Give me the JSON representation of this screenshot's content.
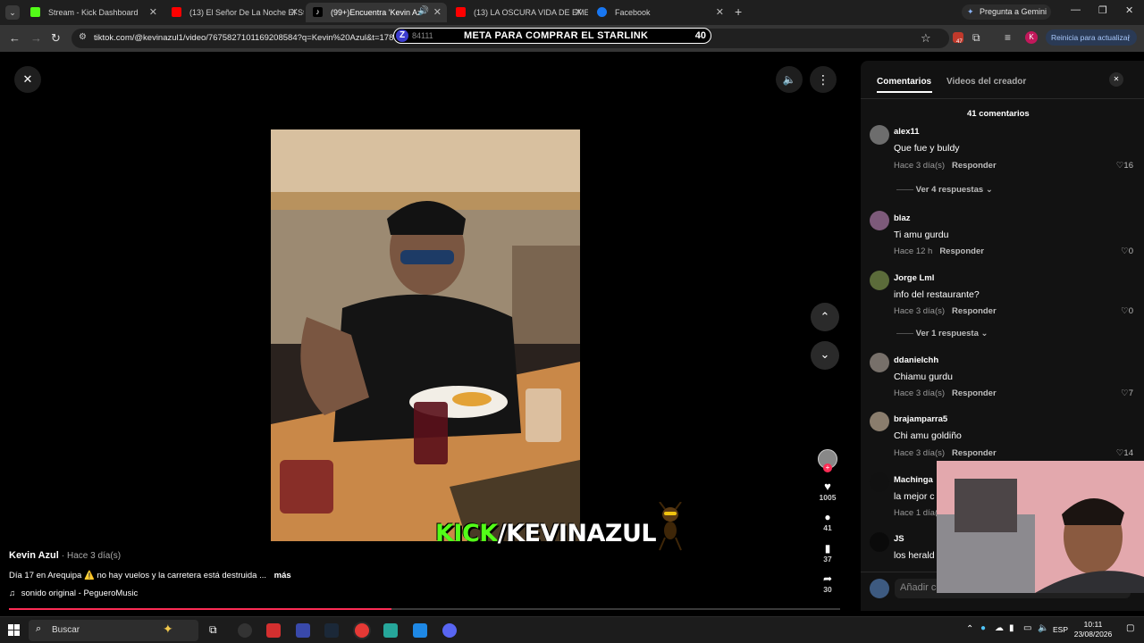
{
  "browser": {
    "tabs": [
      {
        "title": "Stream - Kick Dashboard",
        "icon": "kick-icon",
        "color": "#53fc18"
      },
      {
        "title": "(13) El Señor De La Noche El St",
        "icon": "youtube-icon",
        "color": "#ff0000"
      },
      {
        "title": "(99+)Encuentra 'Kevin Azul'",
        "icon": "tiktok-icon",
        "color": "#ffffff"
      },
      {
        "title": "(13) LA OSCURA VIDA DE EMET",
        "icon": "youtube-icon",
        "color": "#ff0000"
      },
      {
        "title": "Facebook",
        "icon": "facebook-icon",
        "color": "#1877f2"
      }
    ],
    "gemini_label": "Pregunta a Gemini",
    "url": "tiktok.com/@kevinazul1/video/7675827101169208584?q=Kevin%20Azul&t=1787",
    "update_label": "Reinicia para actualizar",
    "profile_initial": "K",
    "extension_badge": "47"
  },
  "stream_overlay": {
    "badge": "Z",
    "sub": "84111",
    "text": "META PARA COMPRAR EL STARLINK",
    "count": "40"
  },
  "video": {
    "author": "Kevin Azul",
    "posted": "· Hace 3 día(s)",
    "caption": "Día 17 en Arequipa ⚠️  no hay vuelos y la carretera está destruida ...",
    "more_label": "más",
    "music": "sonido original - PegueroMusic",
    "watermark_kick": "KICK",
    "watermark_rest": "/KEVINAZUL",
    "progress_pct": 46,
    "actions": {
      "likes": "1005",
      "comments": "41",
      "saves": "37",
      "shares": "30"
    }
  },
  "comments_panel": {
    "tab_comments": "Comentarios",
    "tab_creator": "Videos del creador",
    "count_label": "41 comentarios",
    "input_placeholder": "Añadir c",
    "reply_label": "Responder",
    "items": [
      {
        "user": "alex11",
        "text": "Que fue y buldy",
        "time": "Hace 3 día(s)",
        "likes": "16",
        "more": "Ver 4 respuestas"
      },
      {
        "user": "blaz",
        "text": "Ti amu gurdu",
        "time": "Hace 12 h",
        "likes": "0",
        "more": ""
      },
      {
        "user": "Jorge Lml",
        "text": "info del restaurante?",
        "time": "Hace 3 día(s)",
        "likes": "0",
        "more": "Ver 1 respuesta"
      },
      {
        "user": "ddanielchh",
        "text": "Chiamu gurdu",
        "time": "Hace 3 día(s)",
        "likes": "7",
        "more": ""
      },
      {
        "user": "brajamparra5",
        "text": "Chi amu goldiño",
        "time": "Hace 3 día(s)",
        "likes": "14",
        "more": ""
      },
      {
        "user": "Machinga",
        "text": "la mejor c",
        "time": "Hace 1 día(s)",
        "likes": "",
        "more": ""
      },
      {
        "user": "JS",
        "text": "los herald",
        "time": "",
        "likes": "",
        "more": ""
      }
    ]
  },
  "taskbar": {
    "search_label": "Buscar",
    "lang": "ESP",
    "time": "10:11",
    "date": "23/08/2026"
  }
}
